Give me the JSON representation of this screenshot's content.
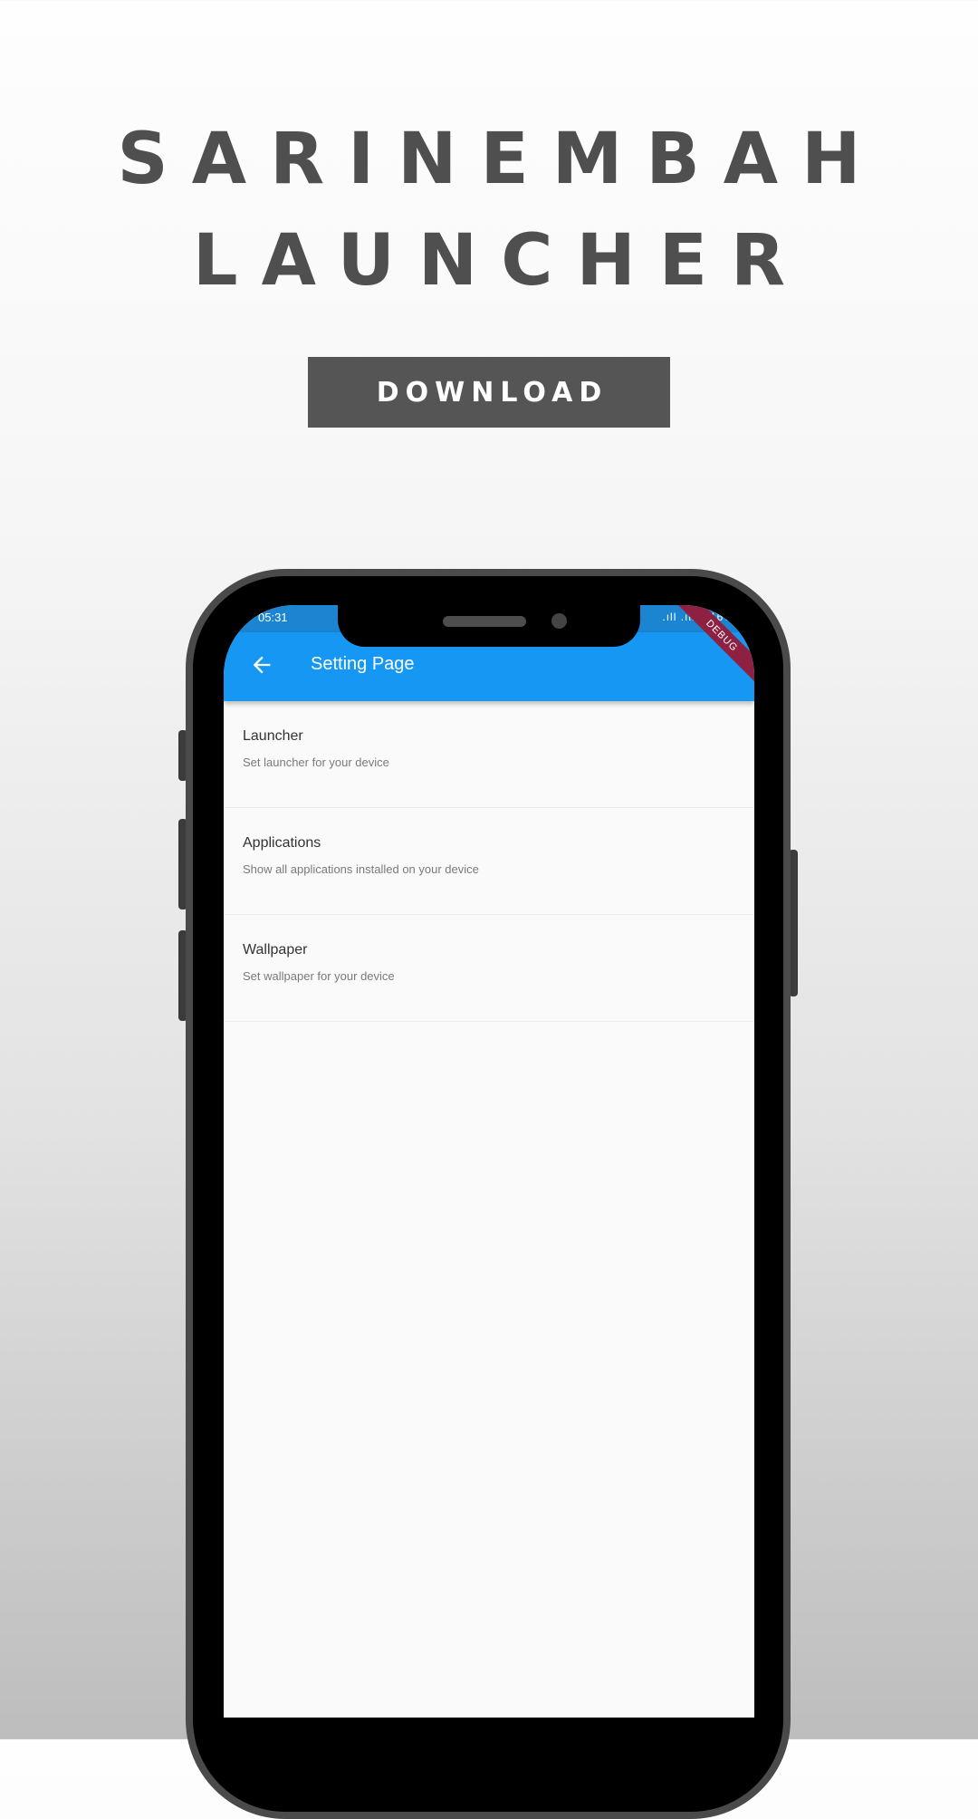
{
  "hero": {
    "title_line1": "SARINEMBAH",
    "title_line2": "LAUNCHER",
    "download_label": "DOWNLOAD"
  },
  "phone": {
    "status_bar": {
      "time": "05:31",
      "icons": ".ıll .ıll ▮ 16%"
    },
    "app_bar": {
      "back_icon": "arrow-left-icon",
      "title": "Setting Page",
      "debug_label": "DEBUG"
    },
    "settings": [
      {
        "title": "Launcher",
        "subtitle": "Set launcher for your device"
      },
      {
        "title": "Applications",
        "subtitle": "Show all applications installed on your device"
      },
      {
        "title": "Wallpaper",
        "subtitle": "Set wallpaper for your device"
      }
    ]
  },
  "colors": {
    "app_bar": "#1597f3",
    "status_bar": "#1b85d1",
    "hero_text": "#4f4f4f",
    "button_bg": "#555555",
    "debug_ribbon": "#8e2142"
  }
}
